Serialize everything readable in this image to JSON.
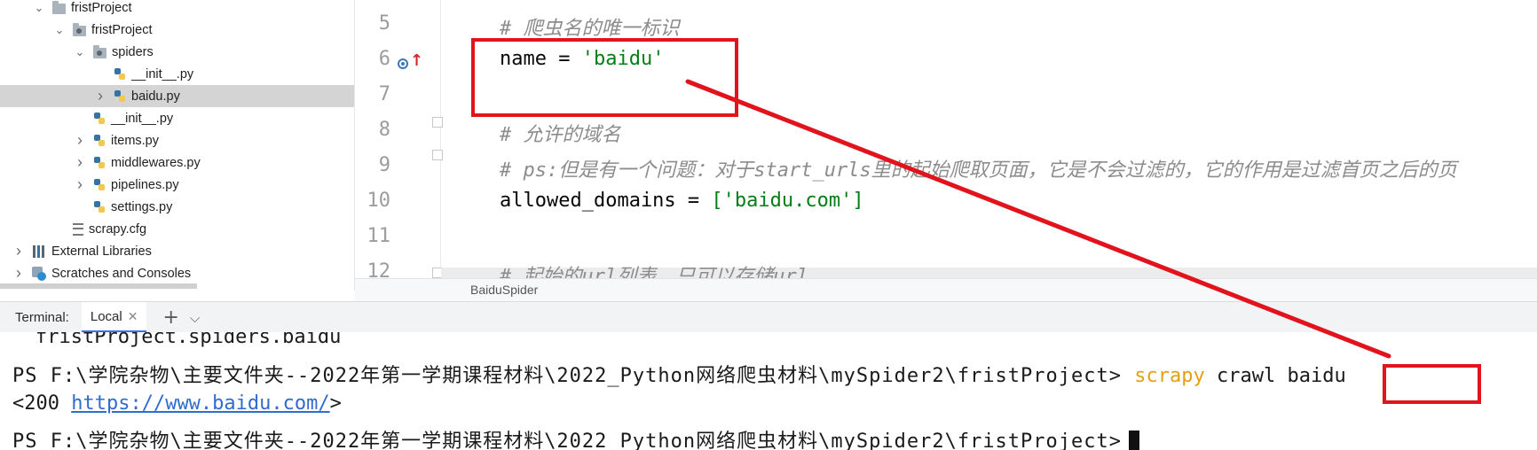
{
  "project_tree": {
    "items": [
      {
        "label": "fristProject",
        "level": 1,
        "expanded": true,
        "icon": "folder-icon"
      },
      {
        "label": "fristProject",
        "level": 2,
        "expanded": true,
        "icon": "package-folder-icon"
      },
      {
        "label": "spiders",
        "level": 3,
        "expanded": true,
        "icon": "package-folder-icon"
      },
      {
        "label": "__init__.py",
        "level": 4,
        "expanded": null,
        "icon": "python-file-icon"
      },
      {
        "label": "baidu.py",
        "level": 4,
        "expanded": false,
        "icon": "python-file-icon",
        "selected": true
      },
      {
        "label": "__init__.py",
        "level": 3,
        "expanded": null,
        "icon": "python-file-icon"
      },
      {
        "label": "items.py",
        "level": 3,
        "expanded": false,
        "icon": "python-file-icon"
      },
      {
        "label": "middlewares.py",
        "level": 3,
        "expanded": false,
        "icon": "python-file-icon"
      },
      {
        "label": "pipelines.py",
        "level": 3,
        "expanded": false,
        "icon": "python-file-icon"
      },
      {
        "label": "settings.py",
        "level": 3,
        "expanded": null,
        "icon": "python-file-icon"
      },
      {
        "label": "scrapy.cfg",
        "level": 2,
        "expanded": null,
        "icon": "config-file-icon"
      },
      {
        "label": "External Libraries",
        "level": 0,
        "expanded": false,
        "icon": "libraries-icon"
      },
      {
        "label": "Scratches and Consoles",
        "level": 0,
        "expanded": false,
        "icon": "scratches-icon"
      }
    ]
  },
  "editor": {
    "lines": [
      {
        "num": "5",
        "segments": [
          {
            "t": "# 爬虫名的唯一标识",
            "c": "cmt"
          }
        ]
      },
      {
        "num": "6",
        "segments": [
          {
            "t": "name = ",
            "c": ""
          },
          {
            "t": "'baidu'",
            "c": "str"
          }
        ]
      },
      {
        "num": "7",
        "segments": []
      },
      {
        "num": "8",
        "segments": [
          {
            "t": "# 允许的域名",
            "c": "cmt"
          }
        ]
      },
      {
        "num": "9",
        "segments": [
          {
            "t": "# ps:但是有一个问题：对于start_urls里的起始爬取页面，它是不会过滤的，它的作用是过滤首页之后的页",
            "c": "cmt"
          }
        ]
      },
      {
        "num": "10",
        "segments": [
          {
            "t": "allowed_domains = ",
            "c": ""
          },
          {
            "t": "['baidu.com']",
            "c": "str"
          }
        ]
      },
      {
        "num": "11",
        "segments": []
      },
      {
        "num": "12",
        "segments": [
          {
            "t": "# 起始的url列表，只可以存储url",
            "c": "cmt"
          }
        ]
      }
    ],
    "breadcrumb": "BaiduSpider"
  },
  "terminal": {
    "label": "Terminal:",
    "tab_label": "Local",
    "add_symbol": "+",
    "more_symbol": "⌵",
    "line1": "fristProject.spiders.baidu",
    "line2_prompt": "PS F:\\学院杂物\\主要文件夹--2022年第一学期课程材料\\2022_Python网络爬虫材料\\mySpider2\\fristProject> ",
    "line2_cmd1": "scrapy",
    "line2_cmd2": " crawl ",
    "line2_cmd3": "baidu",
    "line3_prefix": "<200 ",
    "line3_link": "https://www.baidu.com/",
    "line3_suffix": ">",
    "line4_prompt": "PS F:\\学院杂物\\主要文件夹--2022年第一学期课程材料\\2022_Python网络爬虫材料\\mySpider2\\fristProject>"
  },
  "annotation_color": "#e1141e"
}
